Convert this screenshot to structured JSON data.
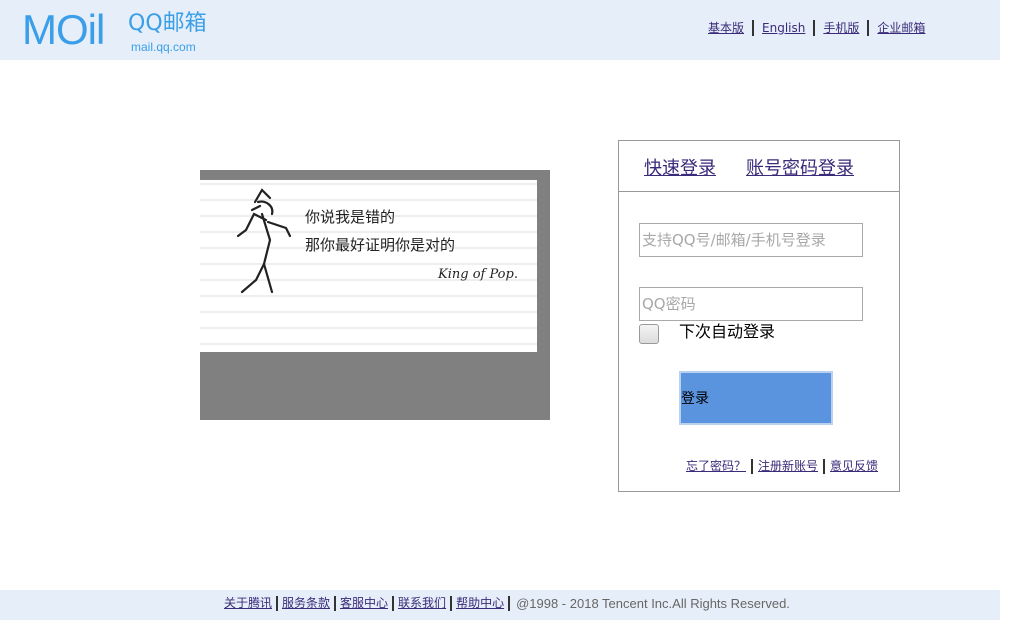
{
  "header": {
    "logo_main": "MOil",
    "logo_qq": "QQ邮箱",
    "logo_url": "mail.qq.com",
    "nav": [
      "基本版",
      "English",
      "手机版",
      "企业邮箱"
    ]
  },
  "picture": {
    "line1": "你说我是错的",
    "line2": "那你最好证明你是对的",
    "signature": "King of Pop."
  },
  "login": {
    "tabs": [
      "快速登录",
      "账号密码登录"
    ],
    "user_placeholder": "支持QQ号/邮箱/手机号登录",
    "pass_placeholder": "QQ密码",
    "remember_label": "下次自动登录",
    "submit_label": "登录",
    "links": [
      "忘了密码？",
      "注册新账号",
      "意见反馈"
    ]
  },
  "footer": {
    "links": [
      "关于腾讯",
      "服务条款",
      "客服中心",
      "联系我们",
      "帮助中心"
    ],
    "copyright": "@1998 - 2018 Tencent Inc.All Rights Reserved."
  },
  "colors": {
    "brand": "#3a9ee8",
    "header_bg": "#e6eff9",
    "button": "#5b94de",
    "link": "#3b2a7a"
  }
}
